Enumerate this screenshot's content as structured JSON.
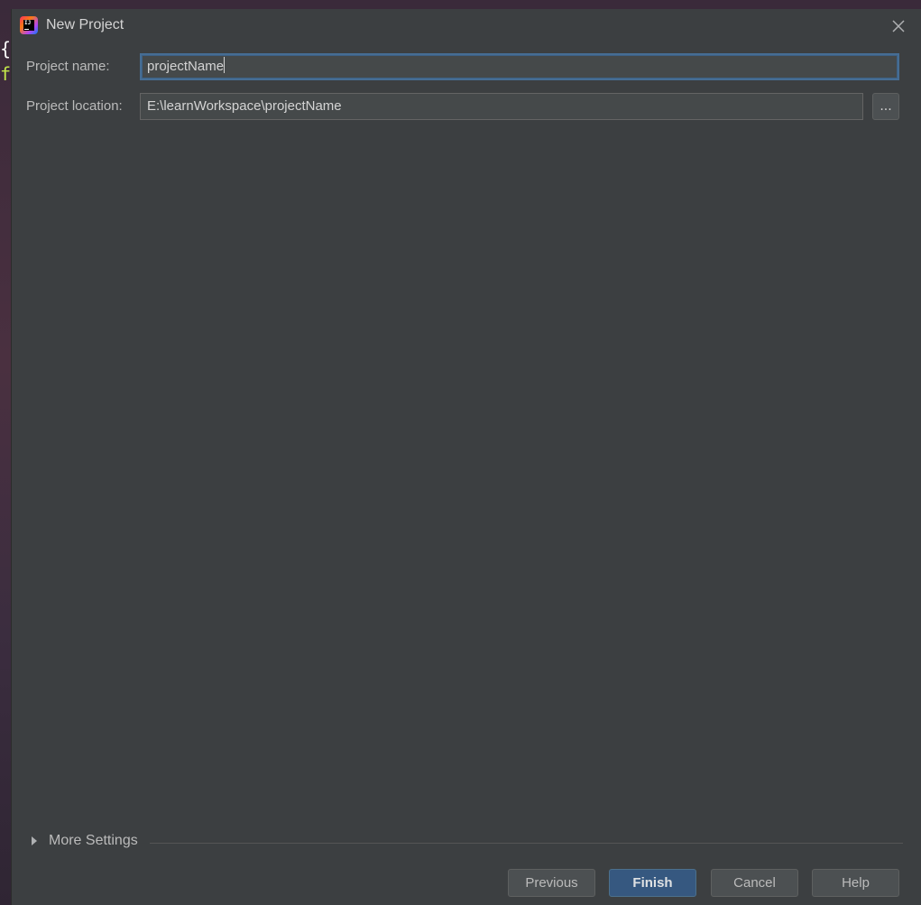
{
  "window": {
    "title": "New Project",
    "close_icon": "close-icon",
    "app_icon": "intellij-idea-icon"
  },
  "backdrop": {
    "code_line_1": "{",
    "code_line_2": "f"
  },
  "form": {
    "project_name": {
      "label": "Project name:",
      "value": "projectName"
    },
    "project_location": {
      "label": "Project location:",
      "value": "E:\\learnWorkspace\\projectName",
      "browse_label": "..."
    }
  },
  "more_settings": {
    "label": "More Settings",
    "expanded": false
  },
  "buttons": {
    "previous": "Previous",
    "finish": "Finish",
    "cancel": "Cancel",
    "help": "Help"
  },
  "colors": {
    "dialog_bg": "#3c3f41",
    "field_bg": "#45494a",
    "focus_border": "#466d94",
    "primary_button": "#365880"
  }
}
